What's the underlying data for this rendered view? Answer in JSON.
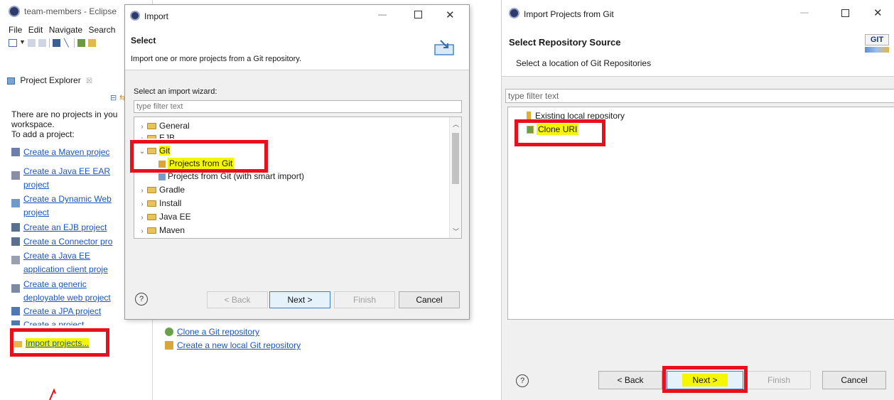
{
  "eclipse": {
    "title": "team-members - Eclipse",
    "menu": [
      "File",
      "Edit",
      "Navigate",
      "Search"
    ],
    "project_explorer_tab": "Project Explorer",
    "empty_message_1": "There are no projects in you",
    "empty_message_2": "workspace.",
    "to_add": "To add a project:",
    "links": [
      {
        "line1": "Create a Maven projec",
        "line2": ""
      },
      {
        "line1": "Create a Java EE EAR",
        "line2": "project"
      },
      {
        "line1": "Create a Dynamic Web",
        "line2": "project"
      },
      {
        "line1": "Create an EJB project",
        "line2": ""
      },
      {
        "line1": "Create a Connector pro",
        "line2": ""
      },
      {
        "line1": "Create a Java EE",
        "line2": "application client proje"
      },
      {
        "line1": "Create a generic",
        "line2": "deployable web project"
      },
      {
        "line1": "Create a JPA project",
        "line2": ""
      },
      {
        "line1": "Create a project...",
        "line2": ""
      }
    ],
    "import_link": "Import projects...",
    "git_links": [
      "Clone a Git repository",
      "Create a new local Git repository"
    ]
  },
  "import_dialog": {
    "title": "Import",
    "heading": "Select",
    "description": "Import one or more projects from a Git repository.",
    "wizard_label": "Select an import wizard:",
    "filter_placeholder": "type filter text",
    "tree": [
      {
        "label": "General",
        "level": 0,
        "expanded": false
      },
      {
        "label": "EJB",
        "level": 0,
        "expanded": false
      },
      {
        "label": "Git",
        "level": 0,
        "expanded": true
      },
      {
        "label": "Projects from Git",
        "level": 1,
        "expanded": false
      },
      {
        "label": "Projects from Git (with smart import)",
        "level": 1,
        "expanded": false
      },
      {
        "label": "Gradle",
        "level": 0,
        "expanded": false
      },
      {
        "label": "Install",
        "level": 0,
        "expanded": false
      },
      {
        "label": "Java EE",
        "level": 0,
        "expanded": false
      },
      {
        "label": "Maven",
        "level": 0,
        "expanded": false
      }
    ],
    "buttons": {
      "back": "< Back",
      "next": "Next >",
      "finish": "Finish",
      "cancel": "Cancel"
    }
  },
  "git_dialog": {
    "title": "Import Projects from Git",
    "heading": "Select Repository Source",
    "description": "Select a location of Git Repositories",
    "badge": "GIT",
    "filter_placeholder": "type filter text",
    "options": [
      "Existing local repository",
      "Clone URI"
    ],
    "buttons": {
      "back": "< Back",
      "next": "Next >",
      "finish": "Finish",
      "cancel": "Cancel"
    }
  },
  "colors": {
    "highlight": "#f4f700",
    "callout_red": "#e8101a",
    "link": "#1a55c4"
  }
}
